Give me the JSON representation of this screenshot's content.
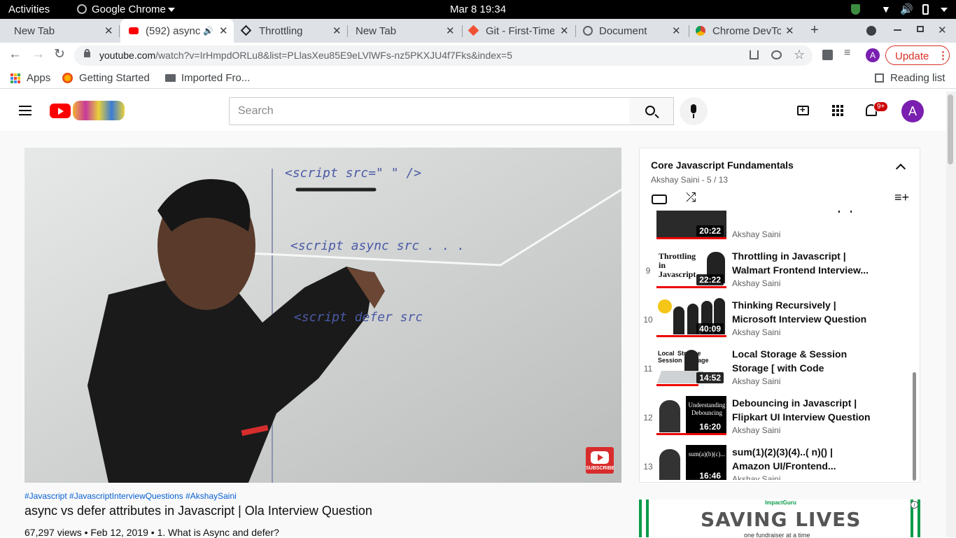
{
  "system": {
    "activities": "Activities",
    "app": "Google Chrome",
    "datetime": "Mar 8  19:34"
  },
  "tabs": [
    {
      "label": "New Tab",
      "icon": "none",
      "active": false
    },
    {
      "label": "(592) async",
      "icon": "youtube-icon",
      "active": true
    },
    {
      "label": "Throttling",
      "icon": "codepen-icon",
      "active": false
    },
    {
      "label": "New Tab",
      "icon": "none",
      "active": false
    },
    {
      "label": "Git - First-Time",
      "icon": "git-icon",
      "active": false
    },
    {
      "label": "Document",
      "icon": "globe-icon",
      "active": false
    },
    {
      "label": "Chrome DevTo",
      "icon": "chrome-icon",
      "active": false
    }
  ],
  "toolbar": {
    "url_domain": "youtube.com",
    "url_path": "/watch?v=IrHmpdORLu8&list=PLlasXeu85E9eLVlWFs-nz5PKXJU4f7Fks&index=5",
    "profile_letter": "A",
    "update_label": "Update"
  },
  "bookmarks": {
    "apps": "Apps",
    "getting_started": "Getting Started",
    "imported": "Imported Fro...",
    "reading_list": "Reading list"
  },
  "youtube": {
    "search_placeholder": "Search",
    "notification_badge": "9+",
    "avatar_letter": "A"
  },
  "video": {
    "hashtags": "#Javascript #JavascriptInterviewQuestions #AkshaySaini",
    "title": "async vs defer attributes in Javascript | Ola Interview Question",
    "meta": "67,297 views • Feb 12, 2019 • 1. What is Async and defer?",
    "subscribe_watermark": "SUBSCRIBE",
    "board_lines": [
      "<script src=\"    \" />",
      "<script  async  src . . .",
      "<script   defer   src"
    ]
  },
  "playlist": {
    "title": "Core Javascript Fundamentals",
    "subtitle": "Akshay Saini - 5 / 13",
    "partial_item": {
      "title": "Inheritance in Javascript |...",
      "duration": "20:22",
      "channel": "Akshay Saini"
    },
    "items": [
      {
        "num": "9",
        "title": "Throttling in Javascript | Walmart Frontend Interview...",
        "duration": "22:22",
        "channel": "Akshay Saini",
        "thumb": "Throttling in Javascript"
      },
      {
        "num": "10",
        "title": "Thinking Recursively | Microsoft Interview Question ...",
        "duration": "40:09",
        "channel": "Akshay Saini",
        "thumb": ""
      },
      {
        "num": "11",
        "title": "Local Storage & Session Storage [ with Code Examples ]",
        "duration": "14:52",
        "channel": "Akshay Saini",
        "thumb": "Local Storage   Session Storage"
      },
      {
        "num": "12",
        "title": "Debouncing in Javascript | Flipkart UI Interview Question",
        "duration": "16:20",
        "channel": "Akshay Saini",
        "thumb": "Understanding Debouncing"
      },
      {
        "num": "13",
        "title": "sum(1)(2)(3)(4)..( n)() | Amazon UI/Frontend...",
        "duration": "16:46",
        "channel": "Akshay Saini",
        "thumb": "sum(a)(b)(c)..."
      }
    ]
  },
  "ad": {
    "brand": "ImpactGuru",
    "headline": "SAVING LIVES",
    "tagline": "one fundraiser at a time"
  },
  "colors": {
    "youtube_red": "#ff0000",
    "avatar_purple": "#7a1fb0",
    "link_blue": "#065fd4"
  }
}
